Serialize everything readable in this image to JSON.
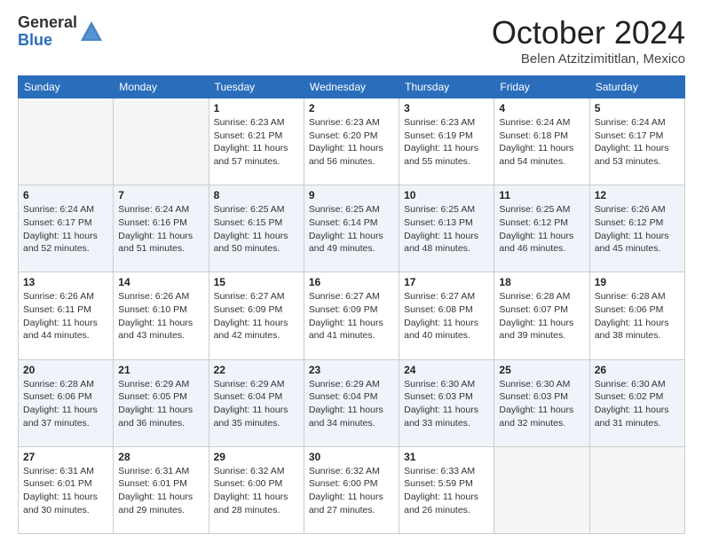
{
  "header": {
    "logo_general": "General",
    "logo_blue": "Blue",
    "month_title": "October 2024",
    "location": "Belen Atzitzimititlan, Mexico"
  },
  "weekdays": [
    "Sunday",
    "Monday",
    "Tuesday",
    "Wednesday",
    "Thursday",
    "Friday",
    "Saturday"
  ],
  "weeks": [
    [
      {
        "day": "",
        "info": ""
      },
      {
        "day": "",
        "info": ""
      },
      {
        "day": "1",
        "info": "Sunrise: 6:23 AM\nSunset: 6:21 PM\nDaylight: 11 hours and 57 minutes."
      },
      {
        "day": "2",
        "info": "Sunrise: 6:23 AM\nSunset: 6:20 PM\nDaylight: 11 hours and 56 minutes."
      },
      {
        "day": "3",
        "info": "Sunrise: 6:23 AM\nSunset: 6:19 PM\nDaylight: 11 hours and 55 minutes."
      },
      {
        "day": "4",
        "info": "Sunrise: 6:24 AM\nSunset: 6:18 PM\nDaylight: 11 hours and 54 minutes."
      },
      {
        "day": "5",
        "info": "Sunrise: 6:24 AM\nSunset: 6:17 PM\nDaylight: 11 hours and 53 minutes."
      }
    ],
    [
      {
        "day": "6",
        "info": "Sunrise: 6:24 AM\nSunset: 6:17 PM\nDaylight: 11 hours and 52 minutes."
      },
      {
        "day": "7",
        "info": "Sunrise: 6:24 AM\nSunset: 6:16 PM\nDaylight: 11 hours and 51 minutes."
      },
      {
        "day": "8",
        "info": "Sunrise: 6:25 AM\nSunset: 6:15 PM\nDaylight: 11 hours and 50 minutes."
      },
      {
        "day": "9",
        "info": "Sunrise: 6:25 AM\nSunset: 6:14 PM\nDaylight: 11 hours and 49 minutes."
      },
      {
        "day": "10",
        "info": "Sunrise: 6:25 AM\nSunset: 6:13 PM\nDaylight: 11 hours and 48 minutes."
      },
      {
        "day": "11",
        "info": "Sunrise: 6:25 AM\nSunset: 6:12 PM\nDaylight: 11 hours and 46 minutes."
      },
      {
        "day": "12",
        "info": "Sunrise: 6:26 AM\nSunset: 6:12 PM\nDaylight: 11 hours and 45 minutes."
      }
    ],
    [
      {
        "day": "13",
        "info": "Sunrise: 6:26 AM\nSunset: 6:11 PM\nDaylight: 11 hours and 44 minutes."
      },
      {
        "day": "14",
        "info": "Sunrise: 6:26 AM\nSunset: 6:10 PM\nDaylight: 11 hours and 43 minutes."
      },
      {
        "day": "15",
        "info": "Sunrise: 6:27 AM\nSunset: 6:09 PM\nDaylight: 11 hours and 42 minutes."
      },
      {
        "day": "16",
        "info": "Sunrise: 6:27 AM\nSunset: 6:09 PM\nDaylight: 11 hours and 41 minutes."
      },
      {
        "day": "17",
        "info": "Sunrise: 6:27 AM\nSunset: 6:08 PM\nDaylight: 11 hours and 40 minutes."
      },
      {
        "day": "18",
        "info": "Sunrise: 6:28 AM\nSunset: 6:07 PM\nDaylight: 11 hours and 39 minutes."
      },
      {
        "day": "19",
        "info": "Sunrise: 6:28 AM\nSunset: 6:06 PM\nDaylight: 11 hours and 38 minutes."
      }
    ],
    [
      {
        "day": "20",
        "info": "Sunrise: 6:28 AM\nSunset: 6:06 PM\nDaylight: 11 hours and 37 minutes."
      },
      {
        "day": "21",
        "info": "Sunrise: 6:29 AM\nSunset: 6:05 PM\nDaylight: 11 hours and 36 minutes."
      },
      {
        "day": "22",
        "info": "Sunrise: 6:29 AM\nSunset: 6:04 PM\nDaylight: 11 hours and 35 minutes."
      },
      {
        "day": "23",
        "info": "Sunrise: 6:29 AM\nSunset: 6:04 PM\nDaylight: 11 hours and 34 minutes."
      },
      {
        "day": "24",
        "info": "Sunrise: 6:30 AM\nSunset: 6:03 PM\nDaylight: 11 hours and 33 minutes."
      },
      {
        "day": "25",
        "info": "Sunrise: 6:30 AM\nSunset: 6:03 PM\nDaylight: 11 hours and 32 minutes."
      },
      {
        "day": "26",
        "info": "Sunrise: 6:30 AM\nSunset: 6:02 PM\nDaylight: 11 hours and 31 minutes."
      }
    ],
    [
      {
        "day": "27",
        "info": "Sunrise: 6:31 AM\nSunset: 6:01 PM\nDaylight: 11 hours and 30 minutes."
      },
      {
        "day": "28",
        "info": "Sunrise: 6:31 AM\nSunset: 6:01 PM\nDaylight: 11 hours and 29 minutes."
      },
      {
        "day": "29",
        "info": "Sunrise: 6:32 AM\nSunset: 6:00 PM\nDaylight: 11 hours and 28 minutes."
      },
      {
        "day": "30",
        "info": "Sunrise: 6:32 AM\nSunset: 6:00 PM\nDaylight: 11 hours and 27 minutes."
      },
      {
        "day": "31",
        "info": "Sunrise: 6:33 AM\nSunset: 5:59 PM\nDaylight: 11 hours and 26 minutes."
      },
      {
        "day": "",
        "info": ""
      },
      {
        "day": "",
        "info": ""
      }
    ]
  ]
}
